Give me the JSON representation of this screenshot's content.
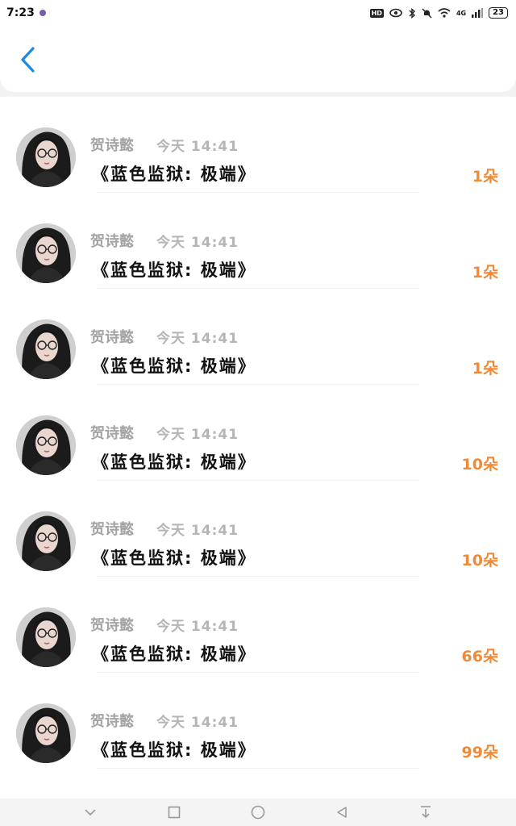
{
  "status_bar": {
    "time": "7:23",
    "network": "4G",
    "hd_label": "HD",
    "battery": "23"
  },
  "colors": {
    "accent": "#1e88e5",
    "count": "#f08a36",
    "name": "#a4a4a4"
  },
  "records": [
    {
      "name": "贺诗懿",
      "time": "今天 14:41",
      "gift": "《蓝色监狱: 极端》",
      "count": "1朵"
    },
    {
      "name": "贺诗懿",
      "time": "今天 14:41",
      "gift": "《蓝色监狱: 极端》",
      "count": "1朵"
    },
    {
      "name": "贺诗懿",
      "time": "今天 14:41",
      "gift": "《蓝色监狱: 极端》",
      "count": "1朵"
    },
    {
      "name": "贺诗懿",
      "time": "今天 14:41",
      "gift": "《蓝色监狱: 极端》",
      "count": "10朵"
    },
    {
      "name": "贺诗懿",
      "time": "今天 14:41",
      "gift": "《蓝色监狱: 极端》",
      "count": "10朵"
    },
    {
      "name": "贺诗懿",
      "time": "今天 14:41",
      "gift": "《蓝色监狱: 极端》",
      "count": "66朵"
    },
    {
      "name": "贺诗懿",
      "time": "今天 14:41",
      "gift": "《蓝色监狱: 极端》",
      "count": "99朵"
    }
  ],
  "icons": {
    "back": "chevron-left-icon",
    "nav": [
      "chevron-down-icon",
      "square-icon",
      "circle-icon",
      "triangle-back-icon",
      "download-icon"
    ]
  }
}
